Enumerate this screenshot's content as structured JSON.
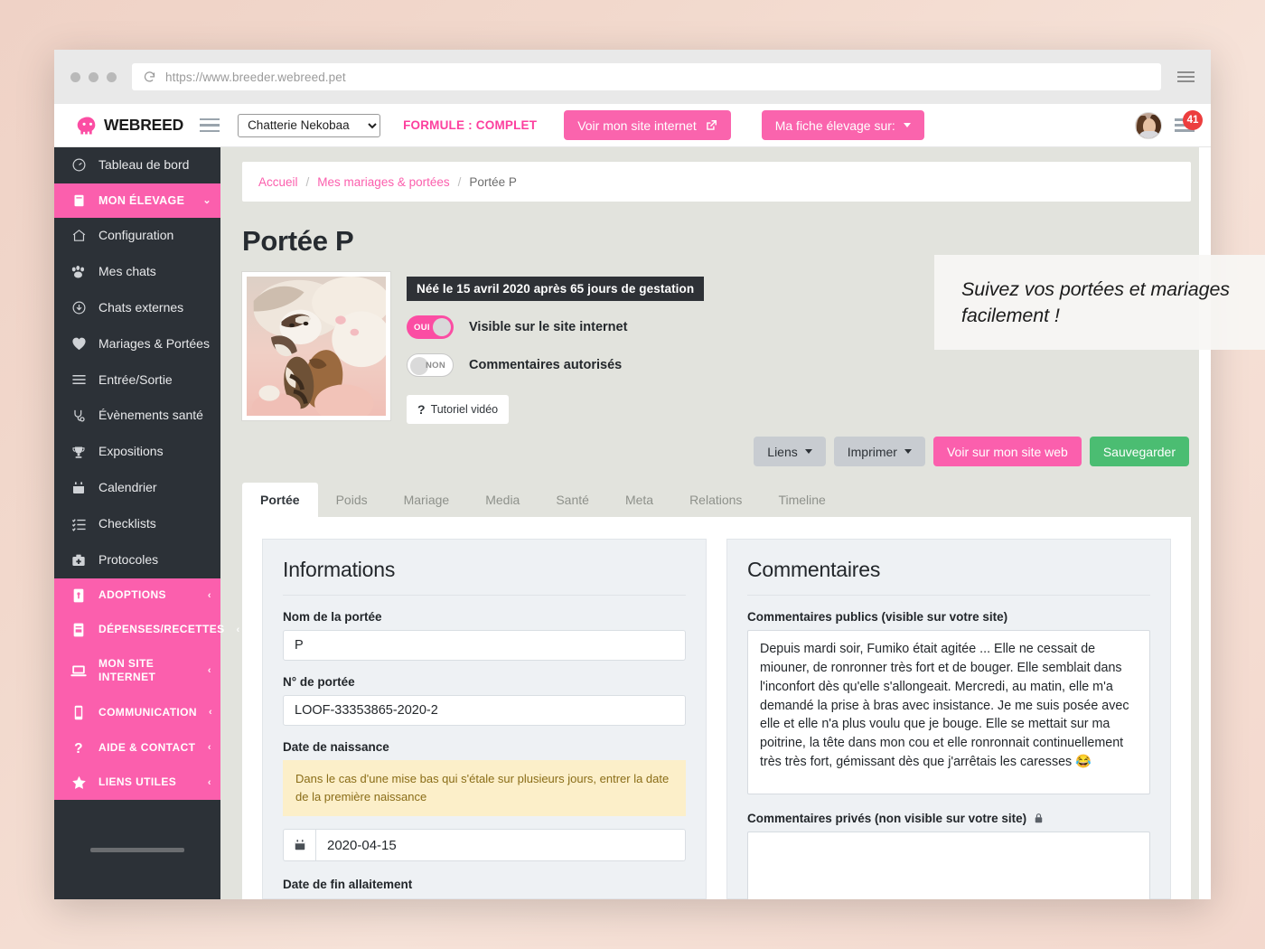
{
  "browser": {
    "url": "https://www.breeder.webreed.pet",
    "reload_icon": "reload-icon",
    "menu_icon": "browser-menu-icon"
  },
  "topnav": {
    "logo_text": "WEBREED",
    "menu_toggle_icon": "hamburger-icon",
    "breeder_select_value": "Chatterie Nekobaa",
    "breeder_select_options": [
      "Chatterie Nekobaa"
    ],
    "formule_label": "FORMULE : COMPLET",
    "site_button_label": "Voir mon site internet",
    "site_button_icon": "external-link-icon",
    "fiche_button_label": "Ma fiche élevage sur:",
    "avatar": "user-avatar",
    "notification_count": "41"
  },
  "sidebar": {
    "items": [
      {
        "label": "Tableau de bord",
        "icon": "dashboard-icon",
        "state": "normal"
      },
      {
        "label": "MON ÉLEVAGE",
        "icon": "book-icon",
        "state": "active"
      },
      {
        "label": "Configuration",
        "icon": "home-icon",
        "state": "normal"
      },
      {
        "label": "Mes chats",
        "icon": "paw-icon",
        "state": "normal"
      },
      {
        "label": "Chats externes",
        "icon": "download-circle-icon",
        "state": "normal"
      },
      {
        "label": "Mariages & Portées",
        "icon": "heart-icon",
        "state": "normal"
      },
      {
        "label": "Entrée/Sortie",
        "icon": "list-icon",
        "state": "normal"
      },
      {
        "label": "Évènements santé",
        "icon": "stethoscope-icon",
        "state": "normal"
      },
      {
        "label": "Expositions",
        "icon": "trophy-icon",
        "state": "normal"
      },
      {
        "label": "Calendrier",
        "icon": "calendar-icon",
        "state": "normal"
      },
      {
        "label": "Checklists",
        "icon": "checklist-icon",
        "state": "normal"
      },
      {
        "label": "Protocoles",
        "icon": "medkit-icon",
        "state": "normal"
      }
    ],
    "sections": [
      {
        "label": "ADOPTIONS",
        "icon": "adoption-icon"
      },
      {
        "label": "DÉPENSES/RECETTES",
        "icon": "ledger-icon"
      },
      {
        "label": "MON SITE INTERNET",
        "icon": "laptop-icon"
      },
      {
        "label": "COMMUNICATION",
        "icon": "mobile-icon"
      },
      {
        "label": "AIDE & CONTACT",
        "icon": "question-icon"
      },
      {
        "label": "LIENS UTILES",
        "icon": "star-icon"
      }
    ],
    "section_chevron": "‹"
  },
  "breadcrumb": {
    "items": [
      "Accueil",
      "Mes mariages & portées",
      "Portée P"
    ],
    "separator": "/"
  },
  "page": {
    "title": "Portée P",
    "thumbnail": "litter-photo"
  },
  "hero": {
    "birth_badge": "Néé le 15 avril 2020 après 65 jours de gestation",
    "toggles": [
      {
        "label": "Visible sur le site internet",
        "state": "OUI",
        "on": true
      },
      {
        "label": "Commentaires autorisés",
        "state": "NON",
        "on": false
      }
    ],
    "tutorial_button": "Tutoriel vidéo",
    "tutorial_icon": "question-mark-icon"
  },
  "actions": [
    {
      "label": "Liens",
      "style": "grey",
      "caret": true
    },
    {
      "label": "Imprimer",
      "style": "grey",
      "caret": true
    },
    {
      "label": "Voir sur mon site web",
      "style": "pink",
      "caret": false
    },
    {
      "label": "Sauvegarder",
      "style": "green",
      "caret": false
    }
  ],
  "tabs": [
    {
      "label": "Portée",
      "active": true
    },
    {
      "label": "Poids",
      "active": false
    },
    {
      "label": "Mariage",
      "active": false
    },
    {
      "label": "Media",
      "active": false
    },
    {
      "label": "Santé",
      "active": false
    },
    {
      "label": "Meta",
      "active": false
    },
    {
      "label": "Relations",
      "active": false
    },
    {
      "label": "Timeline",
      "active": false
    }
  ],
  "informations": {
    "title": "Informations",
    "nom_label": "Nom de la portée",
    "nom_value": "P",
    "numero_label": "N° de portée",
    "numero_value": "LOOF-33353865-2020-2",
    "naissance_label": "Date de naissance",
    "naissance_warning": "Dans le cas d'une mise bas qui s'étale sur plusieurs jours, entrer la date de la première naissance",
    "naissance_value": "2020-04-15",
    "naissance_icon": "calendar-icon",
    "allaitement_label": "Date de fin allaitement"
  },
  "commentaires": {
    "title": "Commentaires",
    "public_label": "Commentaires publics (visible sur votre site)",
    "public_value": "Depuis mardi soir, Fumiko était agitée ... Elle ne cessait de miouner, de ronronner très fort et de bouger. Elle semblait dans l'inconfort dès qu'elle s'allongeait. Mercredi, au matin, elle m'a demandé la prise à bras avec insistance. Je me suis posée avec elle et elle n'a plus voulu que je bouge. Elle se mettait sur ma poitrine, la tête dans mon cou et elle ronronnait continuellement très très fort, gémissant dès que j'arrêtais les caresses 😂",
    "private_label": "Commentaires privés (non visible sur votre site)",
    "private_lock_icon": "lock-icon",
    "private_value": ""
  },
  "callout": {
    "text": "Suivez vos portées et mariages facilement !"
  },
  "colors": {
    "brand_pink": "#fb5fad",
    "accent_pink": "#fc3f9e",
    "sidebar_dark": "#2c3137",
    "success_green": "#4bbd72",
    "badge_red": "#ec3e3e"
  }
}
